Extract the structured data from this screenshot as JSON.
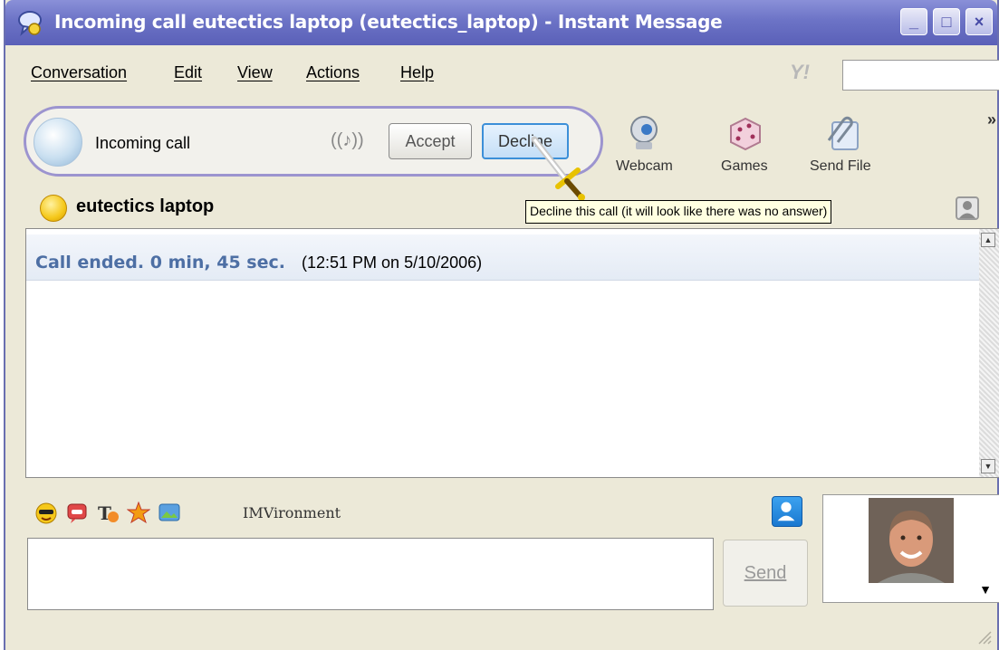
{
  "window": {
    "title": "Incoming call eutectics laptop (eutectics_laptop) - Instant Message",
    "controls": {
      "minimize": "_",
      "maximize": "□",
      "close": "×"
    }
  },
  "menu": {
    "items": [
      {
        "label": "Conversation"
      },
      {
        "label": "Edit"
      },
      {
        "label": "View"
      },
      {
        "label": "Actions"
      },
      {
        "label": "Help"
      }
    ],
    "logo_text": "Y!"
  },
  "call_bar": {
    "label": "Incoming call",
    "accept_label": "Accept",
    "decline_label": "Decline",
    "ringer_icon": "((♪))"
  },
  "toolbar": {
    "tools": [
      {
        "label": "Webcam",
        "icon": "webcam-icon"
      },
      {
        "label": "Games",
        "icon": "dice-icon"
      },
      {
        "label": "Send File",
        "icon": "paperclip-icon"
      }
    ],
    "more": "»"
  },
  "contact": {
    "name": "eutectics laptop"
  },
  "tooltip": {
    "text": "Decline this call (it will look like there was no answer)"
  },
  "conversation": {
    "status_text": "Call ended. 0 min, 45 sec.",
    "timestamp": "(12:51 PM on 5/10/2006)"
  },
  "compose": {
    "imvironment_label": "IMVironment",
    "send_label": "Send",
    "input_value": ""
  },
  "colors": {
    "titlebar": "#6c73c6",
    "status_text": "#4d6fa4",
    "decline_border": "#3c8fd8"
  }
}
